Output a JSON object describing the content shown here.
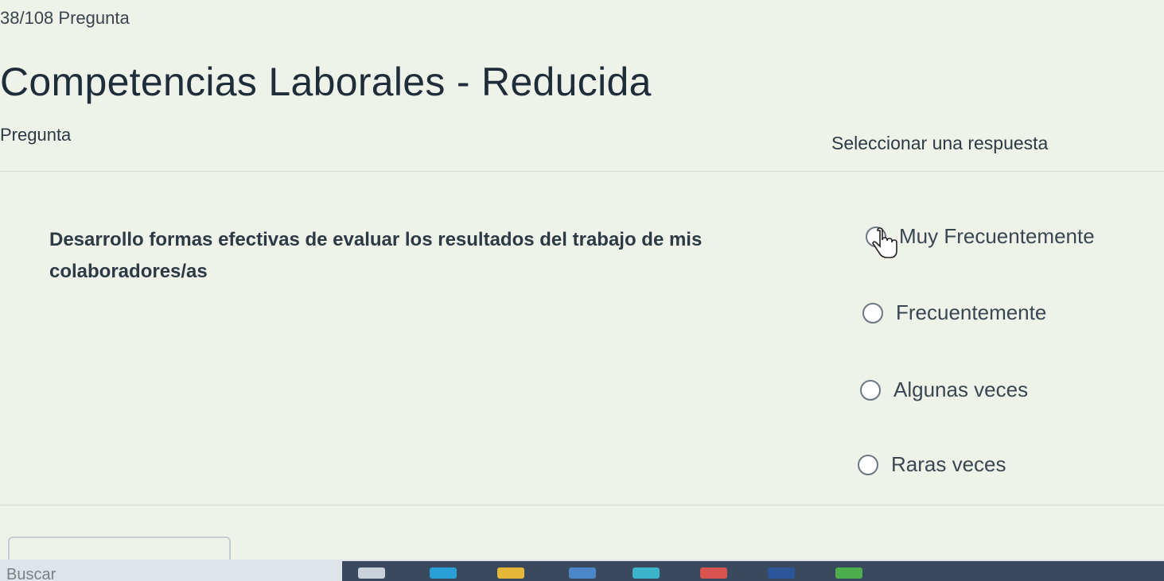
{
  "header": {
    "progress": "38/108 Pregunta",
    "title": "Competencias Laborales - Reducida"
  },
  "table": {
    "question_column": "Pregunta",
    "answer_column": "Seleccionar una respuesta"
  },
  "question": {
    "text": "Desarrollo formas efectivas de evaluar los resultados del trabajo de mis colaboradores/as",
    "options": [
      {
        "label": "Muy Frecuentemente"
      },
      {
        "label": "Frecuentemente"
      },
      {
        "label": "Algunas veces"
      },
      {
        "label": "Raras veces"
      }
    ]
  },
  "taskbar": {
    "search_text": "Buscar",
    "icons": [
      "file-explorer-icon",
      "edge-icon",
      "folder-icon",
      "store-icon",
      "mail-icon",
      "chrome-icon",
      "word-icon",
      "media-icon"
    ]
  },
  "colors": {
    "background": "#eef2e8",
    "text": "#2d3a46",
    "radio_border": "#6d7782",
    "taskbar": "#3a4a5e"
  }
}
